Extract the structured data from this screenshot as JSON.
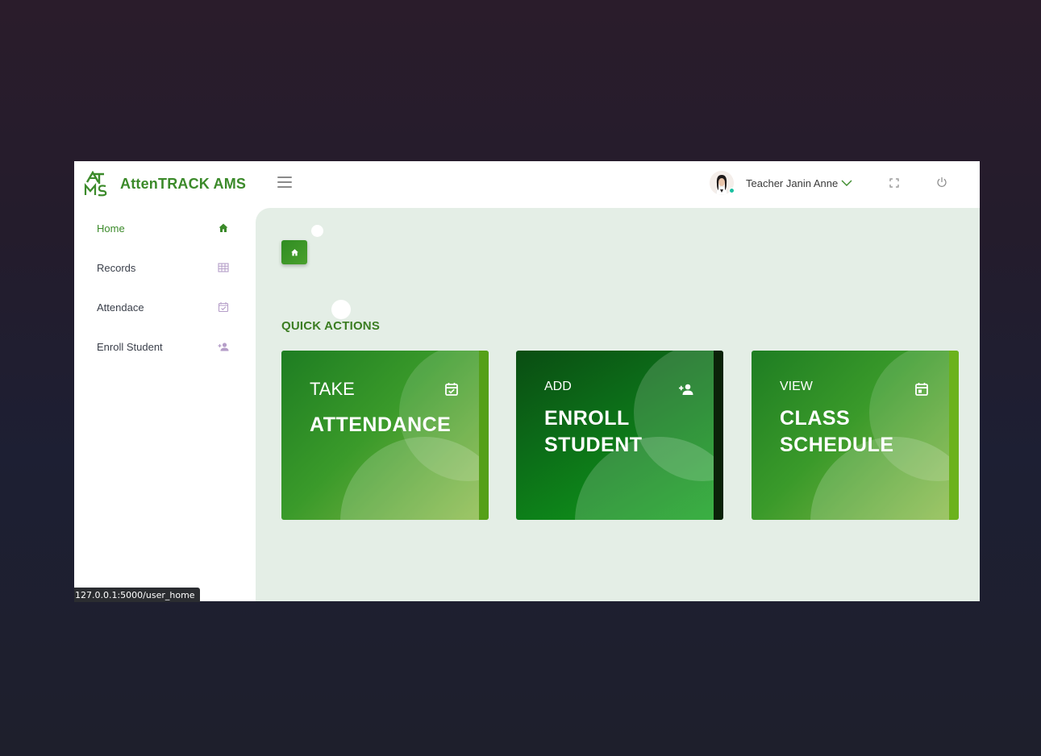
{
  "app": {
    "brand_name": "AttenTRACK AMS"
  },
  "header": {
    "user_name": "Teacher Janin Anne",
    "icons": [
      "menu-icon",
      "chevron-down-icon",
      "fullscreen-icon",
      "power-icon"
    ]
  },
  "sidebar": {
    "items": [
      {
        "label": "Home",
        "icon": "home-icon",
        "active": true
      },
      {
        "label": "Records",
        "icon": "table-icon",
        "active": false
      },
      {
        "label": "Attendace",
        "icon": "calendar-check-icon",
        "active": false
      },
      {
        "label": "Enroll Student",
        "icon": "person-add-icon",
        "active": false
      }
    ]
  },
  "main": {
    "section_title": "QUICK ACTIONS",
    "cards": [
      {
        "small": "TAKE",
        "big_line1": "ATTENDANCE",
        "big_line2": "",
        "icon": "calendar-check-icon"
      },
      {
        "small": "ADD",
        "big_line1": "ENROLL",
        "big_line2": "STUDENT",
        "icon": "person-add-icon"
      },
      {
        "small": "VIEW",
        "big_line1": "CLASS",
        "big_line2": "SCHEDULE",
        "icon": "calendar-icon"
      }
    ]
  },
  "status_bar": {
    "url": "127.0.0.1:5000/user_home"
  },
  "colors": {
    "brand_green": "#3b8a2a",
    "content_bg": "#e4eee6",
    "online_dot": "#19c0a0"
  }
}
